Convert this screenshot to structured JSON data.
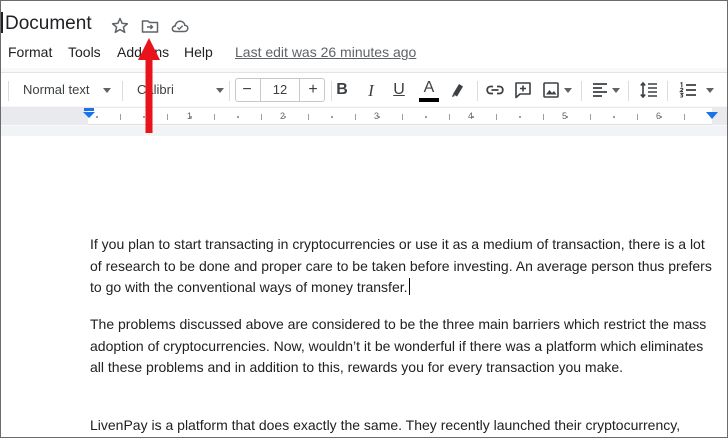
{
  "title_bar": {
    "doc_title": "Document",
    "icons": [
      "star-icon",
      "move-to-folder-icon",
      "cloud-saved-icon"
    ]
  },
  "menu": {
    "items": [
      "Format",
      "Tools",
      "Add-ons",
      "Help"
    ],
    "last_edit": "Last edit was 26 minutes ago"
  },
  "toolbar": {
    "style": "Normal text",
    "font": "Calibri",
    "font_size": "12",
    "decrease": "−",
    "increase": "+",
    "bold": "B",
    "italic": "I",
    "underline": "U",
    "text_color": "A",
    "icons": [
      "highlight-icon",
      "link-icon",
      "comment-icon",
      "image-icon",
      "align-icon",
      "line-spacing-icon",
      "numbered-list-icon"
    ]
  },
  "ruler": {
    "numbers": [
      "1",
      "2",
      "3",
      "4",
      "5",
      "6"
    ]
  },
  "document": {
    "paragraphs": [
      "If you plan to start transacting in cryptocurrencies or use it as a medium of transaction, there is a lot of research to be done and proper care to be taken before investing. An average person thus prefers to go with the conventional ways of money transfer.",
      "The problems discussed above are considered to be the three main barriers which restrict the mass adoption of cryptocurrencies. Now, wouldn’t it be wonderful if there was a platform which eliminates all these problems and in addition to this, rewards you for every transaction you make.",
      "LivenPay is a platform that does exactly the same. They recently launched their cryptocurrency,"
    ]
  },
  "colors": {
    "annotation_arrow": "#e8131b",
    "ruler_marker": "#1a73e8",
    "text_color_underline": "#000000"
  }
}
